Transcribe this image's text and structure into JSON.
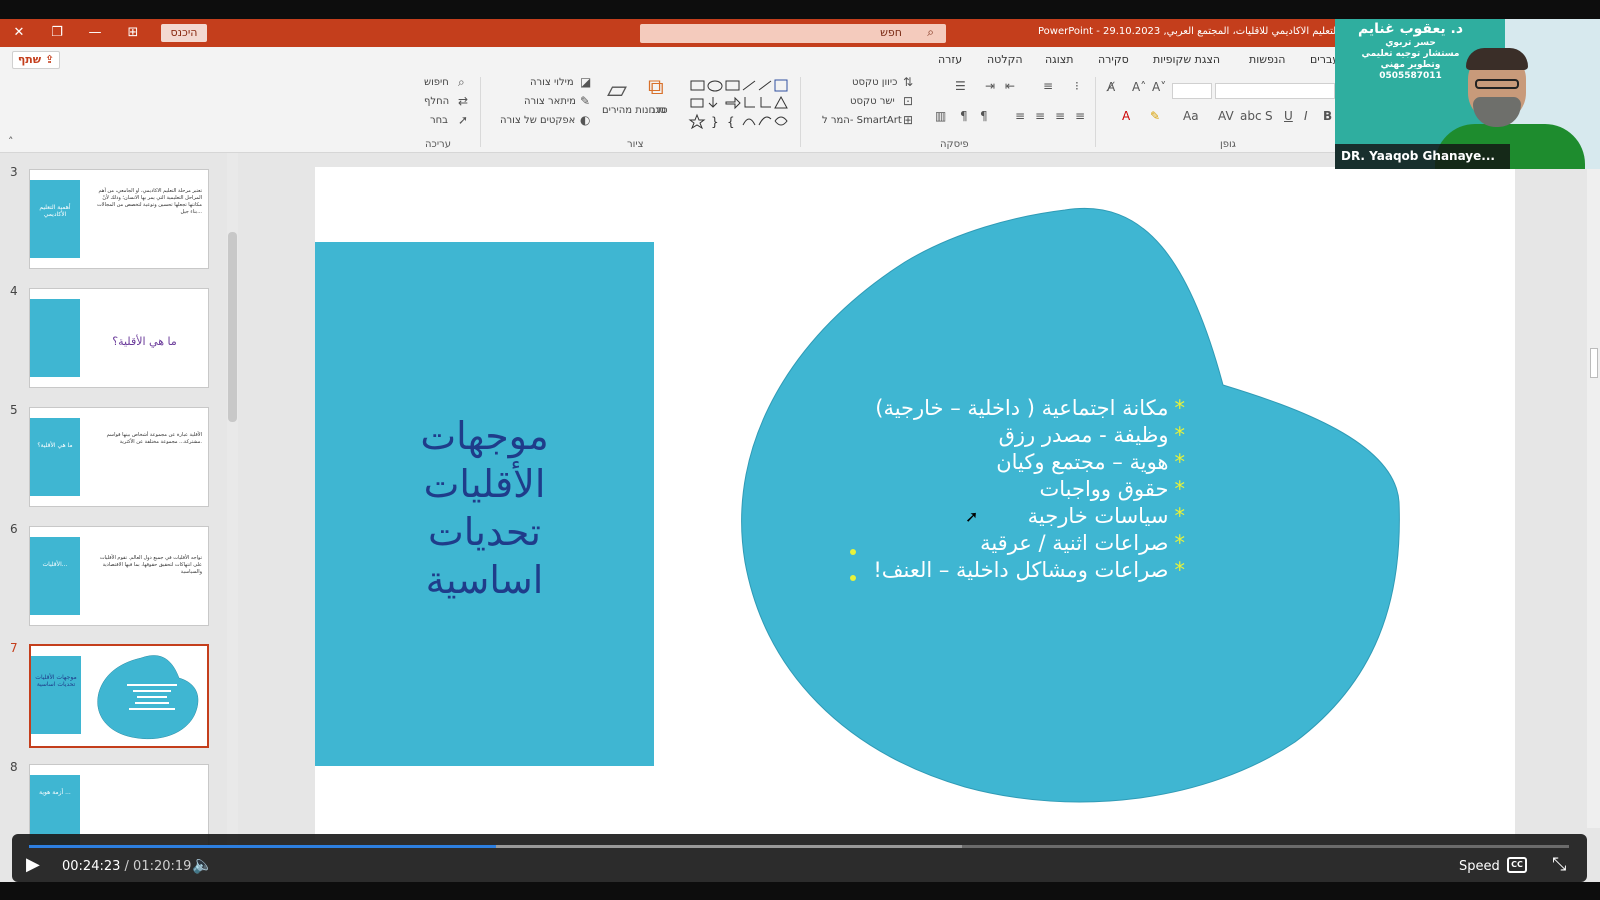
{
  "titlebar": {
    "doc_title": "PowerPoint  -  29.10.2023 ,التعليم الاكاديمي للاقليات، المجتمع العربي",
    "search_placeholder": "חפש",
    "signin_label": "היכנס",
    "close": "✕",
    "restore": "❐",
    "minimize": "—",
    "ribbon_display": "⊞"
  },
  "ribbon": {
    "share_label": "שתף",
    "tabs": [
      "עזרה",
      "הקלטה",
      "תצוגה",
      "סקירה",
      "הצגת שקופיות",
      "הנפשות",
      "מעברים"
    ],
    "groups": {
      "editing": "עריכה",
      "drawing": "ציור",
      "paragraph": "פיסקה",
      "font": "גופן"
    },
    "editing_items": [
      "חיפוש",
      "החלף",
      "בחר"
    ],
    "drawing_items": [
      "מילוי צורה",
      "מיתאר צורה",
      "אפקטים של צורה",
      "סגנונות מהירים",
      "סדר"
    ],
    "paragraph_items": [
      "כיוון טקסט",
      "ישר טקסט",
      "המר ל- SmartArt"
    ],
    "font_letters": [
      "B",
      "I",
      "U",
      "S"
    ]
  },
  "thumbnails": [
    {
      "num": "3",
      "box_text": "أهمية التعليم الأكاديمي",
      "body": "تعتبر مرحلة التعليم الاكاديمي، او الجامعي، من أهم المراحل التعليمية التي يمر بها الانسان؛ وذلك لأنّ مكانتها تجعلها تحسين وتوعية لتخصص من المجالات بناء جيل..."
    },
    {
      "num": "4",
      "box_text": "",
      "big": "ما هي الأقلية؟"
    },
    {
      "num": "5",
      "box_text": "ما هي الأقلية؟",
      "body": "الأقلية عبارة عن مجموعة أشخاص بينها قواسم مشتركة... مجموعة مختلفة عن الأكثرية."
    },
    {
      "num": "6",
      "box_text": "الأقليات...",
      "body": "تواجه الأقليات في جميع دول العالم. تقوم الأقليات على انتهاكات لتحقيق حقوقها، بما فيها الاقتصادية والسياسية"
    },
    {
      "num": "7",
      "box_text": "موجهات الأقليات تحديات اساسية",
      "active": true
    },
    {
      "num": "8",
      "box_text": "أزمة هوية ..."
    }
  ],
  "slide": {
    "title_lines": [
      "موجهات",
      "الأقليات",
      "تحديات",
      "اساسية"
    ],
    "bullets": [
      "مكانة اجتماعية ( داخلية – خارجية)",
      "وظيفة - مصدر رزق",
      "هوية – مجتمع وكيان",
      "حقوق وواجبات",
      "سياسات خارجية",
      "صراعات اثنية / عرقية",
      "صراعات ومشاكل داخلية – العنف!"
    ],
    "colors": {
      "box": "#3fb6d2",
      "blob": "#3fb6d2",
      "title": "#1f3c8a",
      "star": "#e7f23a"
    }
  },
  "webcam": {
    "name_ar": "د. يعقوب غنايم",
    "lines": [
      "حسر تربوي",
      "مستشار توجيه تعليمي",
      "وتطوير مهني",
      "0505587011"
    ],
    "label": "DR. Yaaqob Ghanaye..."
  },
  "player": {
    "current_time": "00:24:23",
    "separator": " / ",
    "duration": "01:20:19",
    "speed_label": "Speed",
    "cc_label": "CC",
    "progress": 0.3035
  }
}
